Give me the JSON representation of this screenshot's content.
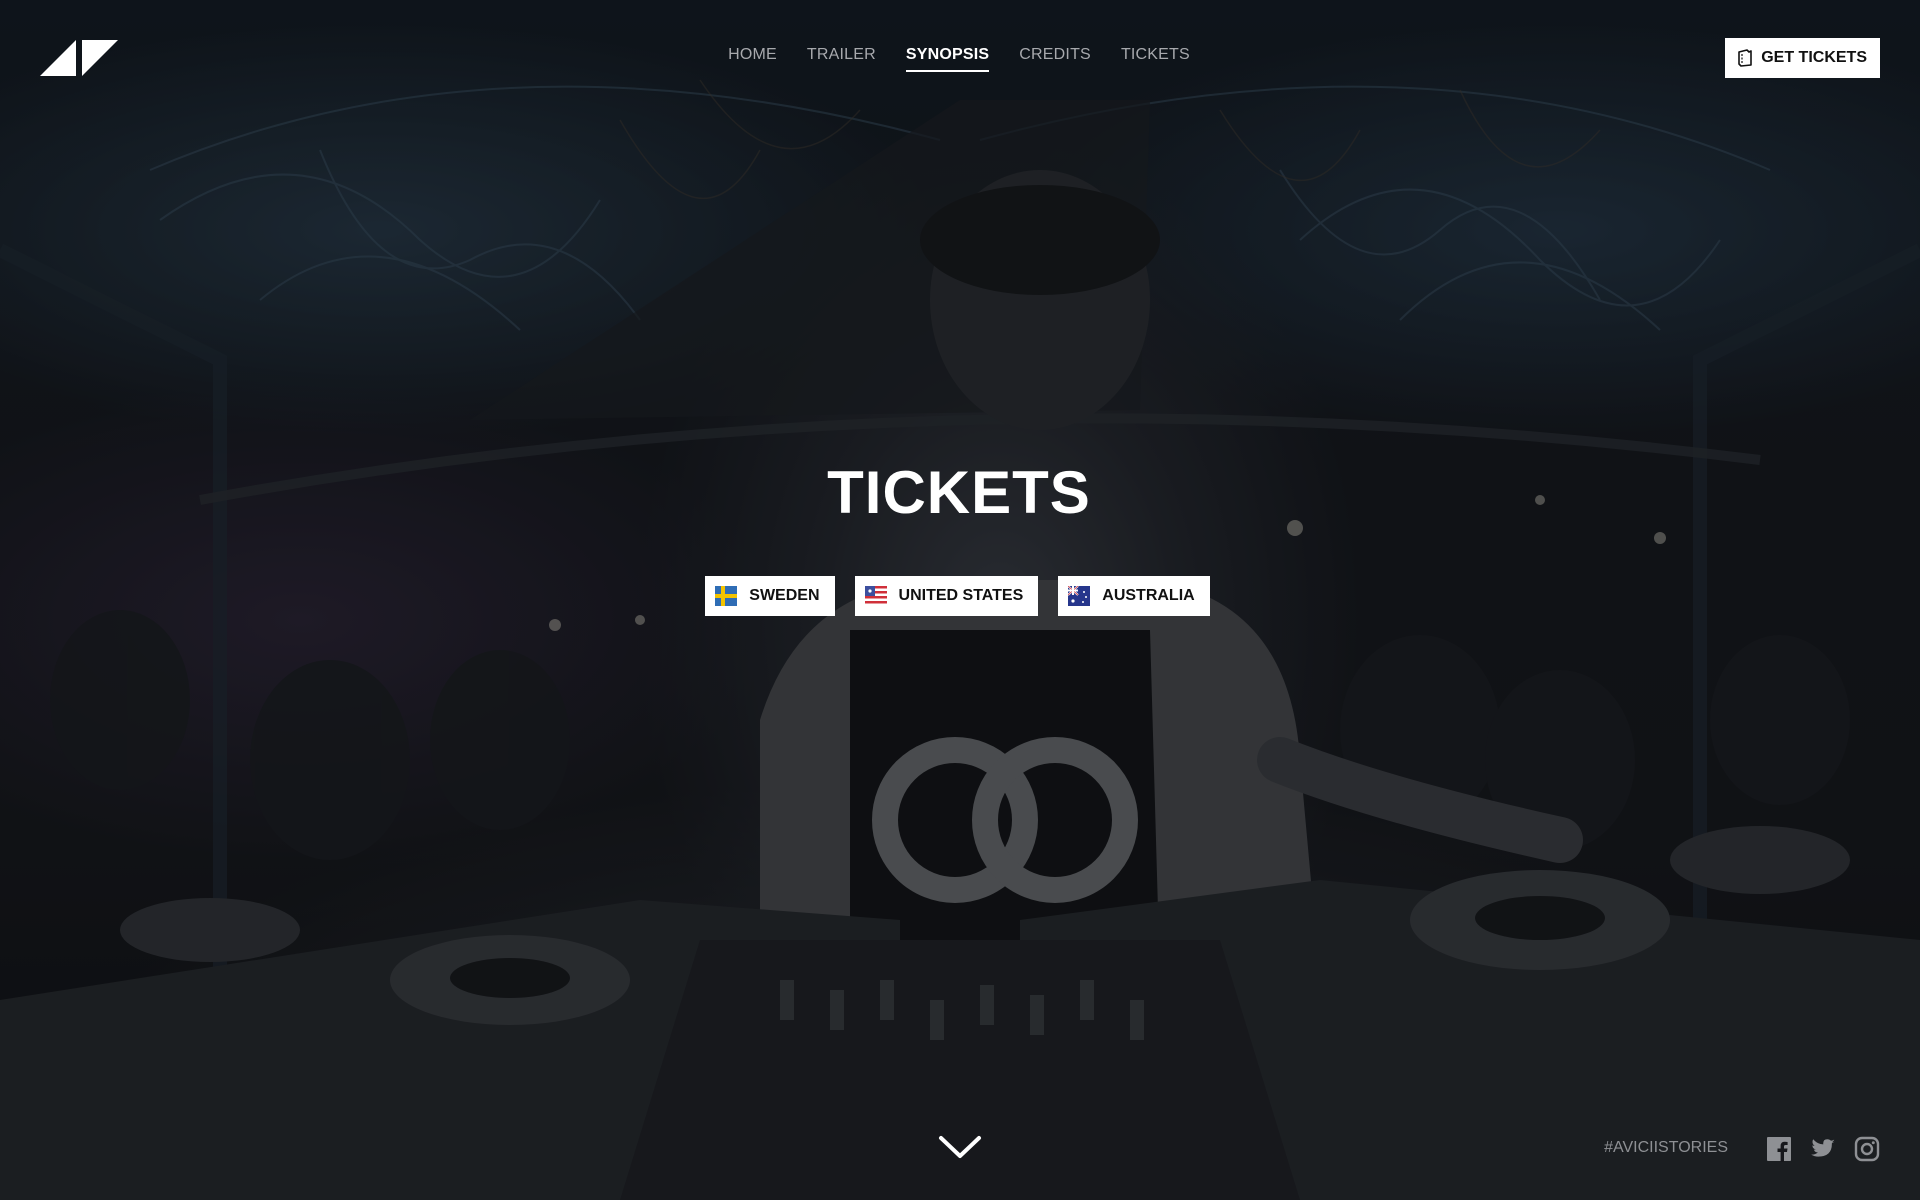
{
  "nav": {
    "items": [
      {
        "label": "HOME",
        "active": false
      },
      {
        "label": "TRAILER",
        "active": false
      },
      {
        "label": "SYNOPSIS",
        "active": true
      },
      {
        "label": "CREDITS",
        "active": false
      },
      {
        "label": "TICKETS",
        "active": false
      }
    ]
  },
  "header": {
    "logo_icon": "avicii-logo-icon",
    "get_tickets_label": "GET TICKETS",
    "get_tickets_icon": "ticket-icon"
  },
  "hero": {
    "title": "TICKETS",
    "countries": [
      {
        "label": "SWEDEN",
        "flag_icon": "sweden-flag-icon"
      },
      {
        "label": "UNITED STATES",
        "flag_icon": "us-flag-icon"
      },
      {
        "label": "AUSTRALIA",
        "flag_icon": "australia-flag-icon"
      }
    ]
  },
  "footer": {
    "scroll_icon": "chevron-down-icon",
    "hashtag": "#AVICIISTORIES",
    "social": [
      "facebook-icon",
      "twitter-icon",
      "instagram-icon"
    ]
  },
  "colors": {
    "accent": "#ffffff",
    "nav_inactive": "#a7a9ad",
    "background": "#14161b"
  }
}
